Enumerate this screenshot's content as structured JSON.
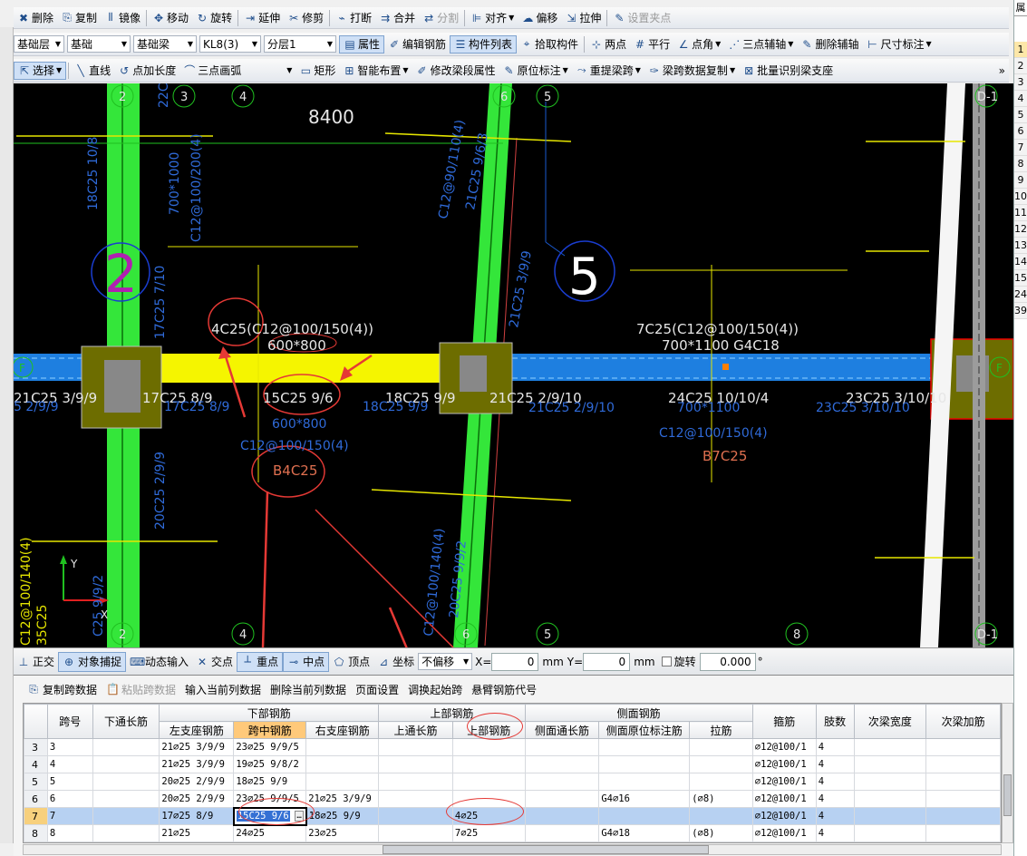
{
  "toolbar1": {
    "items": [
      "删除",
      "复制",
      "镜像",
      "移动",
      "旋转",
      "延伸",
      "修剪",
      "打断",
      "合并",
      "分割",
      "对齐",
      "偏移",
      "拉伸",
      "设置夹点"
    ]
  },
  "toolbar2": {
    "floor": "基础层",
    "category": "基础",
    "type": "基础梁",
    "member": "KL8(3)",
    "layer": "分层1",
    "items": [
      "属性",
      "编辑钢筋",
      "构件列表",
      "拾取构件",
      "两点",
      "平行",
      "点角",
      "三点辅轴",
      "删除辅轴",
      "尺寸标注"
    ]
  },
  "toolbar3": {
    "select": "选择",
    "items": [
      "直线",
      "点加长度",
      "三点画弧",
      "矩形",
      "智能布置",
      "修改梁段属性",
      "原位标注",
      "重提梁跨",
      "梁跨数据复制",
      "批量识别梁支座"
    ],
    "more": "»"
  },
  "canvas": {
    "texts": {
      "dim_8400": "8400",
      "axis_2_big": "2",
      "axis_5_big": "5",
      "ann_left_top": "4C25(C12@100/150(4))",
      "ann_left_size": "600*800",
      "ann_right_top": "7C25(C12@100/150(4))",
      "ann_right_size": "700*1100 G4C18",
      "left_support": "21C25 3/9/9",
      "left_support2": "17C25 8/9",
      "mid_span": "15C25 9/6",
      "mid_right": "18C25 9/9",
      "col_support": "21C25 2/9/10",
      "right_mid": "24C25 10/10/4",
      "right_end": "23C25 3/10/10",
      "blue_600": "600*800",
      "blue_c12": "C12@100/150(4)",
      "b4c25": "B4C25",
      "blue_700": "700*1100",
      "blue_c12b": "C12@100/150(4)",
      "b7c25": "B7C25",
      "blue_18c25": "18C25 9/9",
      "blue_21c25": "21C25 2/9/10",
      "blue_23c25": "23C25 3/10/10",
      "blue_17c25": "17C25 8/9",
      "blue_5_29": "5 2/9/9",
      "vert_1": "18C25 10/8",
      "vert_2": "700*1000",
      "vert_3": "C12@100/200(4)",
      "vert_4": "17C25 7/10",
      "vert_5": "20C25 2/9/9",
      "vert_6": "C12@90/110(4)",
      "vert_7": "21C25 9/6/3",
      "vert_8": "21C25 3/9/9",
      "vert_9": "C12@100/140(4)",
      "vert_10": "20C25 9/9/2",
      "vert_11": "C12@100/140(4)",
      "vert_12": "C25 9/9/2",
      "vert_13": "35C25",
      "vert_14": "22C",
      "axis_labels_top": [
        "2",
        "3",
        "4",
        "6",
        "5",
        "D-1"
      ],
      "axis_labels_bot": [
        "2",
        "4",
        "6",
        "5",
        "8",
        "D-1"
      ],
      "axis_F": "F",
      "coord_y": "Y",
      "coord_x": "X"
    }
  },
  "statusbar": {
    "items": [
      "正交",
      "对象捕捉",
      "动态输入",
      "交点",
      "重点",
      "中点",
      "顶点",
      "坐标"
    ],
    "offset": "不偏移",
    "x_label": "X=",
    "x_value": "0",
    "y_label": "Y=",
    "y_value": "0",
    "unit": "mm",
    "rotate_label": "旋转",
    "rotate_value": "0.000",
    "deg": "°"
  },
  "panel": {
    "toolbar": [
      "复制跨数据",
      "粘贴跨数据",
      "输入当前列数据",
      "删除当前列数据",
      "页面设置",
      "调换起始跨",
      "悬臂钢筋代号"
    ],
    "group_headers": {
      "bottom": "下部钢筋",
      "top": "上部钢筋",
      "side": "侧面钢筋"
    },
    "columns": [
      "",
      "跨号",
      "下通长筋",
      "左支座钢筋",
      "跨中钢筋",
      "右支座钢筋",
      "上通长筋",
      "上部钢筋",
      "侧面通长筋",
      "侧面原位标注筋",
      "拉筋",
      "箍筋",
      "肢数",
      "次梁宽度",
      "次梁加筋"
    ],
    "rows": [
      {
        "n": "3",
        "span": "3",
        "bot_through": "",
        "left": "21⌀25 3/9/9",
        "mid": "23⌀25 9/9/5",
        "right": "",
        "top_through": "",
        "top": "",
        "side_through": "",
        "side_in": "",
        "tie": "",
        "stirrup": "⌀12@100/1",
        "legs": "4",
        "sec_w": "",
        "sec_add": ""
      },
      {
        "n": "4",
        "span": "4",
        "bot_through": "",
        "left": "21⌀25 3/9/9",
        "mid": "19⌀25 9/8/2",
        "right": "",
        "top_through": "",
        "top": "",
        "side_through": "",
        "side_in": "",
        "tie": "",
        "stirrup": "⌀12@100/1",
        "legs": "4",
        "sec_w": "",
        "sec_add": ""
      },
      {
        "n": "5",
        "span": "5",
        "bot_through": "",
        "left": "20⌀25 2/9/9",
        "mid": "18⌀25 9/9",
        "right": "",
        "top_through": "",
        "top": "",
        "side_through": "",
        "side_in": "",
        "tie": "",
        "stirrup": "⌀12@100/1",
        "legs": "4",
        "sec_w": "",
        "sec_add": ""
      },
      {
        "n": "6",
        "span": "6",
        "bot_through": "",
        "left": "20⌀25 2/9/9",
        "mid": "23⌀25 9/9/5",
        "right": "21⌀25 3/9/9",
        "top_through": "",
        "top": "",
        "side_through": "",
        "side_in": "G4⌀16",
        "tie": "(⌀8)",
        "stirrup": "⌀12@100/1",
        "legs": "4",
        "sec_w": "",
        "sec_add": ""
      },
      {
        "n": "7",
        "span": "7",
        "bot_through": "",
        "left": "17⌀25 8/9",
        "mid": "15C25 9/6",
        "right": "18⌀25 9/9",
        "top_through": "",
        "top": "4⌀25",
        "side_through": "",
        "side_in": "",
        "tie": "",
        "stirrup": "⌀12@100/1",
        "legs": "4",
        "sec_w": "",
        "sec_add": ""
      },
      {
        "n": "8",
        "span": "8",
        "bot_through": "",
        "left": "21⌀25",
        "mid": "24⌀25",
        "right": "23⌀25",
        "top_through": "",
        "top": "7⌀25",
        "side_through": "",
        "side_in": "G4⌀18",
        "tie": "(⌀8)",
        "stirrup": "⌀12@100/1",
        "legs": "4",
        "sec_w": "",
        "sec_add": ""
      }
    ],
    "selected_row": "7"
  },
  "rightpanel": {
    "title": "属",
    "rows": [
      "1",
      "2",
      "3",
      "4",
      "5",
      "6",
      "7",
      "8",
      "9",
      "10",
      "11",
      "12",
      "13",
      "14",
      "15",
      "24",
      "39"
    ]
  }
}
